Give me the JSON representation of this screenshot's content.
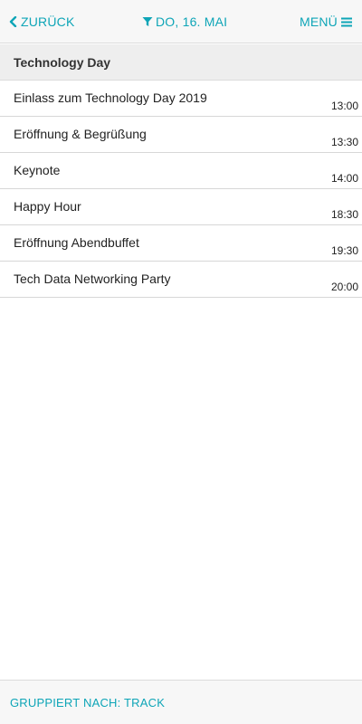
{
  "header": {
    "back_label": "ZURÜCK",
    "back_icon": "chevron-left-icon",
    "filter_label": "DO, 16. MAI",
    "filter_icon": "filter-icon",
    "menu_label": "MENÜ",
    "menu_icon": "hamburger-menu-icon",
    "accent_color": "#0ea5b7"
  },
  "section": {
    "title": "Technology Day"
  },
  "events": [
    {
      "title": "Einlass zum Technology Day 2019",
      "time": "13:00"
    },
    {
      "title": "Eröffnung & Begrüßung",
      "time": "13:30"
    },
    {
      "title": "Keynote",
      "time": "14:00"
    },
    {
      "title": "Happy Hour",
      "time": "18:30"
    },
    {
      "title": "Eröffnung Abendbuffet",
      "time": "19:30"
    },
    {
      "title": "Tech Data Networking Party",
      "time": "20:00"
    }
  ],
  "footer": {
    "group_label": "GRUPPIERT NACH: TRACK"
  }
}
